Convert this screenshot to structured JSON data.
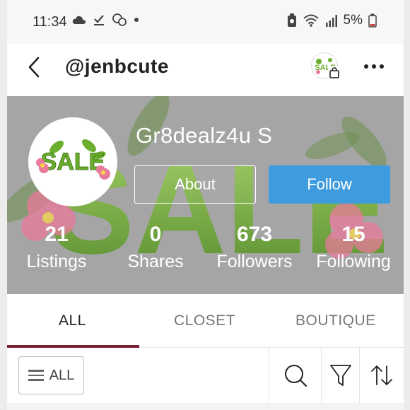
{
  "status_bar": {
    "time": "11:34",
    "battery_pct": "5%",
    "icons": [
      "cloud-icon",
      "download-check-icon",
      "chat-bubbles-icon",
      "dot-icon",
      "battery-saver-icon",
      "wifi-icon",
      "signal-icon",
      "battery-icon"
    ]
  },
  "header": {
    "handle": "@jenbcute",
    "shop_avatar_text": "SALE"
  },
  "profile": {
    "display_name": "Gr8dealz4u S",
    "avatar_text": "SALE",
    "about_label": "About",
    "follow_label": "Follow",
    "banner_text": "SALE",
    "stats": [
      {
        "value": "21",
        "label": "Listings"
      },
      {
        "value": "0",
        "label": "Shares"
      },
      {
        "value": "673",
        "label": "Followers"
      },
      {
        "value": "15",
        "label": "Following"
      }
    ]
  },
  "tabs": [
    {
      "label": "ALL",
      "active": true
    },
    {
      "label": "CLOSET",
      "active": false
    },
    {
      "label": "BOUTIQUE",
      "active": false
    }
  ],
  "filter_bar": {
    "filter_label": "ALL",
    "tools": [
      "search-icon",
      "filter-icon",
      "sort-icon"
    ]
  },
  "colors": {
    "follow_button": "#3e9bde",
    "tab_underline": "#7a1f32",
    "banner_overlay": "#9a9a9a",
    "sale_green": "#6cae2e",
    "flower_pink": "#e87a9a"
  }
}
